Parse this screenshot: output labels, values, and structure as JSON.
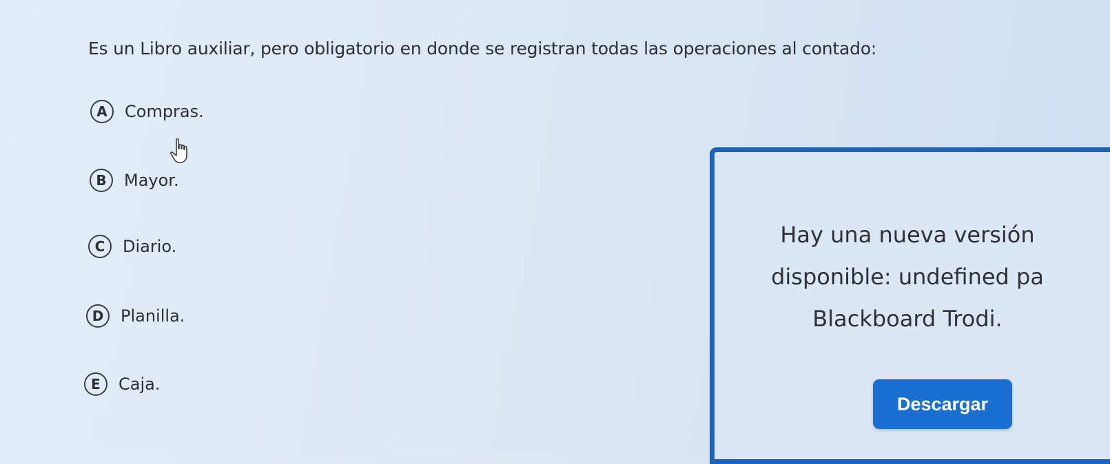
{
  "question": {
    "text": "Es un Libro auxiliar, pero obligatorio en donde se registran todas las operaciones al contado:"
  },
  "options": [
    {
      "letter": "A",
      "label": "Compras."
    },
    {
      "letter": "B",
      "label": "Mayor."
    },
    {
      "letter": "C",
      "label": "Diario."
    },
    {
      "letter": "D",
      "label": "Planilla."
    },
    {
      "letter": "E",
      "label": "Caja."
    }
  ],
  "popup": {
    "message_lines": [
      "Hay una nueva versión",
      "disponible: undefined pa",
      "Blackboard Trodi."
    ],
    "download_label": "Descargar"
  },
  "colors": {
    "accent": "#1d63b9",
    "button": "#1a6fd2"
  },
  "icons": {
    "cursor": "hand-pointer-icon"
  }
}
